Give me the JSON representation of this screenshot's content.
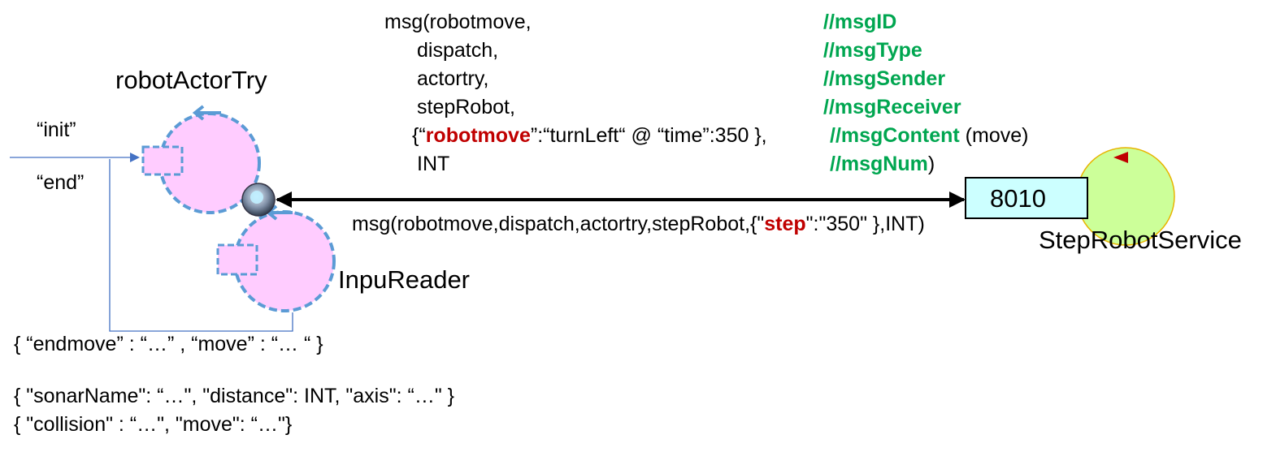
{
  "labels": {
    "actor_main": "robotActorTry",
    "actor_reader": "InpuReader",
    "service_name": "StepRobotService",
    "port": "8010",
    "init": "“init”",
    "end": "“end”"
  },
  "msg_spec": {
    "lines": [
      "msg(robotmove,",
      "dispatch,",
      "actortry,",
      "stepRobot,"
    ],
    "content_open": "{“",
    "content_key": "robotmove",
    "content_rest": "”:“turnLeft“ @ “time”:350 },",
    "last_line": "INT",
    "comments": [
      "//msgID",
      "//msgType",
      "//msgSender",
      "//msgReceiver",
      "//msgContent",
      "//msgNum"
    ],
    "comment_content_suffix": " (move)",
    "comment_num_suffix": ")"
  },
  "msg_example": {
    "prefix": "msg(robotmove,dispatch,actortry,stepRobot,{\"",
    "key": "step",
    "suffix": "\":\"350\" },INT)"
  },
  "events": [
    "{ “endmove” : “…” , “move” : “… “ }",
    "{ \"sonarName\": “…\", \"distance\": INT, \"axis\": “…\" }",
    "{ \"collision\" : “…\", \"move\": “…\"}"
  ],
  "colors": {
    "actor_fill": "#ffccff",
    "actor_stroke": "#5b9bd5",
    "service_fill": "#ccff99",
    "port_fill": "#ccffff",
    "comment_green": "#00a650",
    "key_red": "#c00000"
  }
}
